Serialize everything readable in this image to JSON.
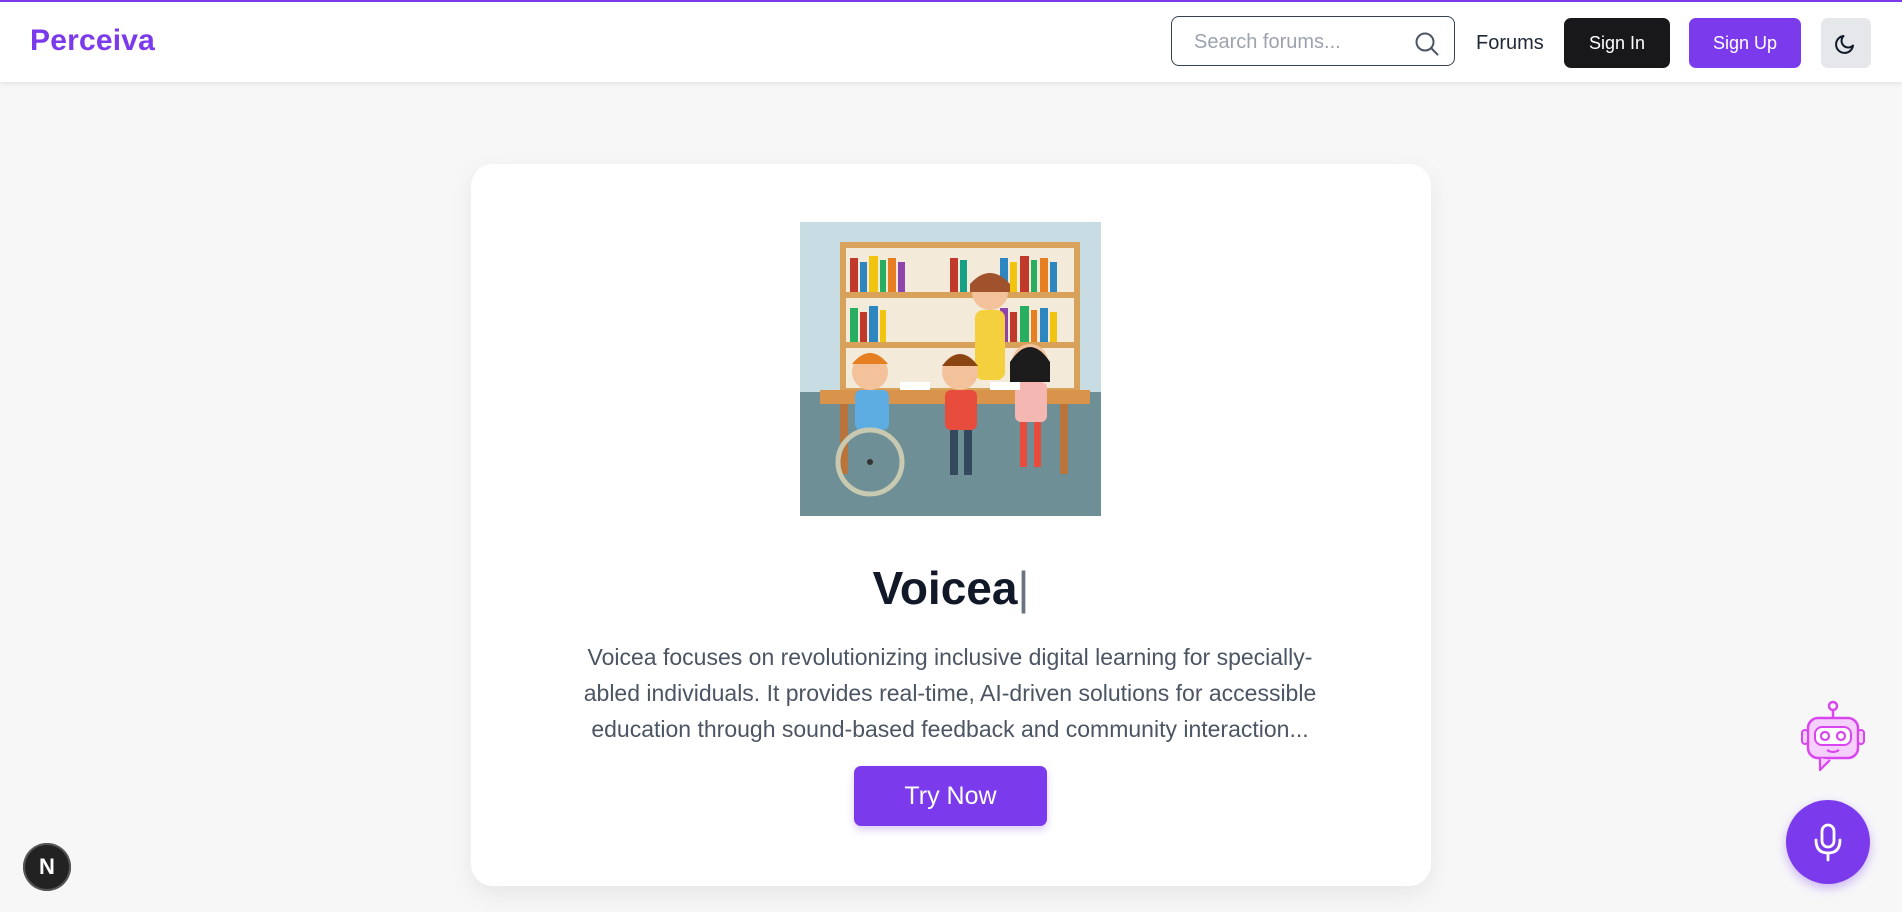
{
  "header": {
    "brand": "Perceiva",
    "search": {
      "placeholder": "Search forums...",
      "value": ""
    },
    "forums_link": "Forums",
    "sign_in": "Sign In",
    "sign_up": "Sign Up",
    "theme_icon": "moon-icon"
  },
  "hero": {
    "image_icon": "library-illustration",
    "title": "Voicea",
    "caret": "|",
    "description": "Voicea focuses on revolutionizing inclusive digital learning for specially-abled individuals. It provides real-time, AI-driven solutions for accessible education through sound-based feedback and community interaction...",
    "cta": "Try Now"
  },
  "floating": {
    "dev_badge": "N",
    "chatbot_icon": "robot-icon",
    "mic_icon": "microphone-icon"
  },
  "colors": {
    "accent": "#7c3aed",
    "dark": "#18181b",
    "text_muted": "#4b5563"
  }
}
